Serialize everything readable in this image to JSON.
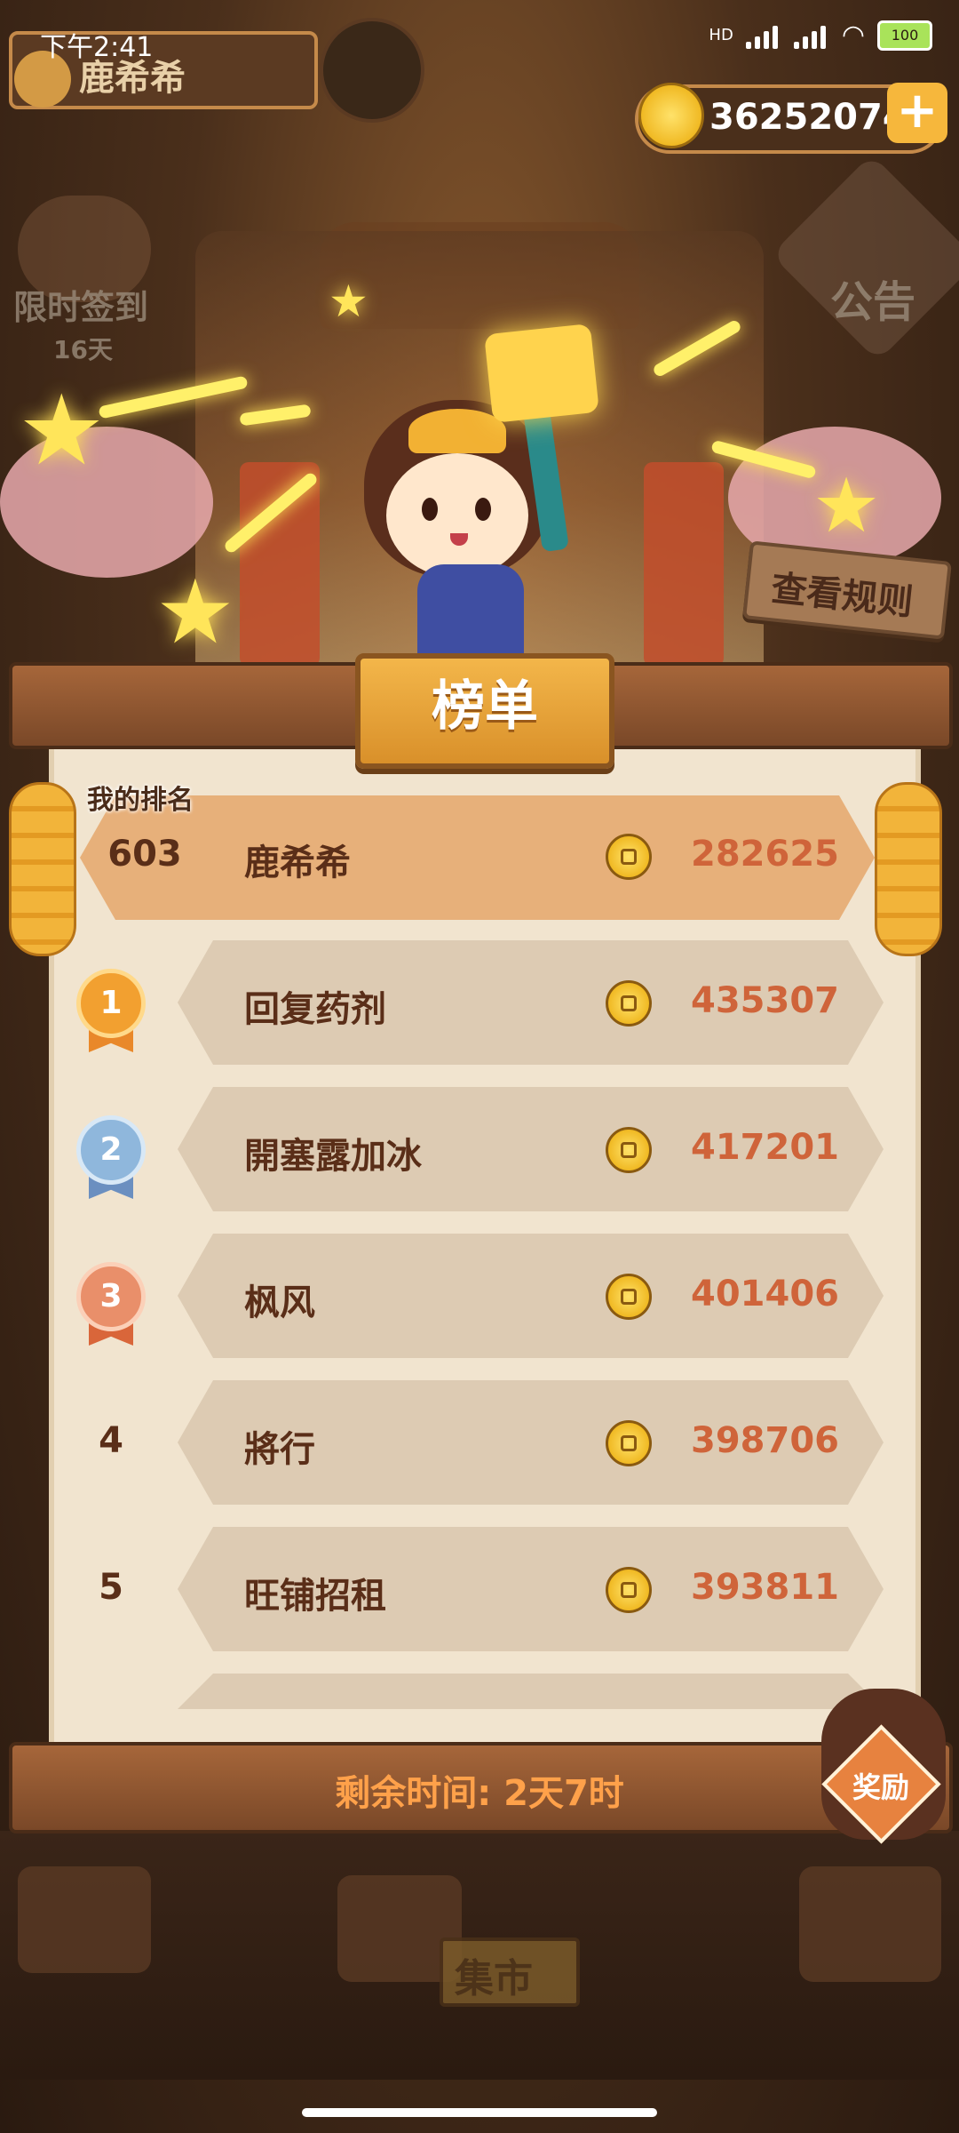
{
  "status_bar": {
    "time": "下午2:41",
    "battery": "100",
    "network": "HD"
  },
  "header": {
    "player_name": "鹿希希",
    "coins": "36252074",
    "plus_label": "+"
  },
  "side_menu": {
    "checkin_label": "限时签到",
    "checkin_days": "16天",
    "notice_label": "公告"
  },
  "rules_button": "查看规则",
  "leaderboard": {
    "title": "榜单",
    "my_rank_label": "我的排名",
    "my_entry": {
      "rank": "603",
      "name": "鹿希希",
      "score": "282625"
    },
    "entries": [
      {
        "rank": "1",
        "name": "回复药剂",
        "score": "435307",
        "medal": "gold"
      },
      {
        "rank": "2",
        "name": "開塞露加冰",
        "score": "417201",
        "medal": "silver"
      },
      {
        "rank": "3",
        "name": "枫风",
        "score": "401406",
        "medal": "bronze"
      },
      {
        "rank": "4",
        "name": "將行",
        "score": "398706",
        "medal": ""
      },
      {
        "rank": "5",
        "name": "旺铺招租",
        "score": "393811",
        "medal": ""
      }
    ],
    "remaining_time": "剩余时间: 2天7时"
  },
  "reward_button": "奖励",
  "market_label": "集市",
  "colors": {
    "gold_medal": "#f2a030",
    "silver_medal": "#8fb7dc",
    "bronze_medal": "#e98f6a",
    "score": "#cf643a",
    "name": "#5a2e18"
  }
}
